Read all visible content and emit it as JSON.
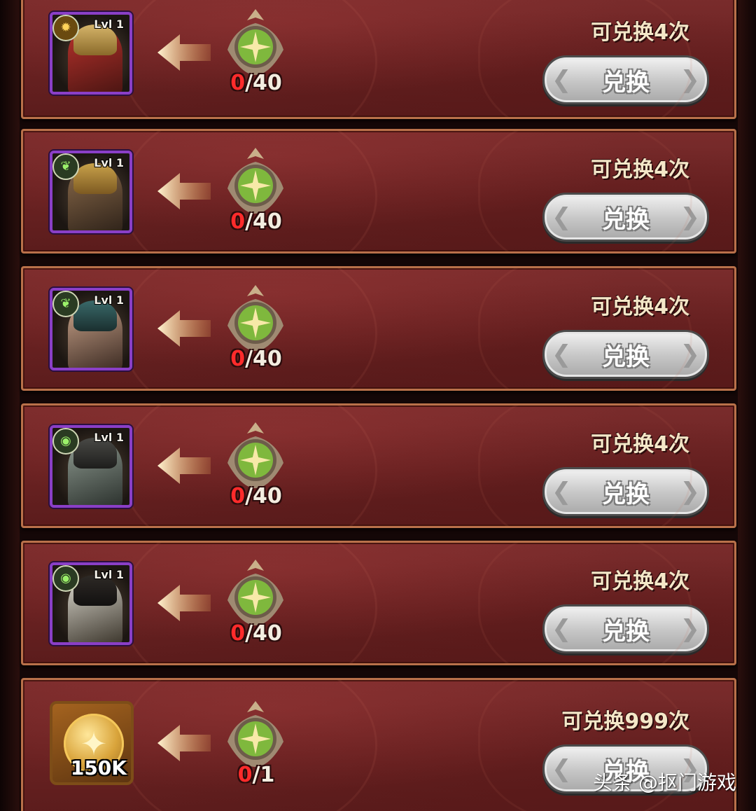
{
  "colors": {
    "row_bg": "#6a2222",
    "row_border": "#b9714a",
    "progress_current": "#ff2b2b",
    "button_bg": "#c9c9c9",
    "portrait_border": "#8a3fc7"
  },
  "rows": [
    {
      "type": "hero",
      "level": "Lvl 1",
      "faction_icon": "sun-faction-icon",
      "progress_current": "0",
      "progress_max": "40",
      "limit": "可兑换4次",
      "button": "兑换"
    },
    {
      "type": "hero",
      "level": "Lvl 1",
      "faction_icon": "leaf-faction-icon",
      "progress_current": "0",
      "progress_max": "40",
      "limit": "可兑换4次",
      "button": "兑换"
    },
    {
      "type": "hero",
      "level": "Lvl 1",
      "faction_icon": "leaf-faction-icon",
      "progress_current": "0",
      "progress_max": "40",
      "limit": "可兑换4次",
      "button": "兑换"
    },
    {
      "type": "hero",
      "level": "Lvl 1",
      "faction_icon": "eye-faction-icon",
      "progress_current": "0",
      "progress_max": "40",
      "limit": "可兑换4次",
      "button": "兑换"
    },
    {
      "type": "hero",
      "level": "Lvl 1",
      "faction_icon": "eye-faction-icon",
      "progress_current": "0",
      "progress_max": "40",
      "limit": "可兑换4次",
      "button": "兑换"
    },
    {
      "type": "gold",
      "amount": "150K",
      "progress_current": "0",
      "progress_max": "1",
      "limit": "可兑换999次",
      "button": "兑换"
    }
  ],
  "watermark": "头条 @抠门游戏"
}
